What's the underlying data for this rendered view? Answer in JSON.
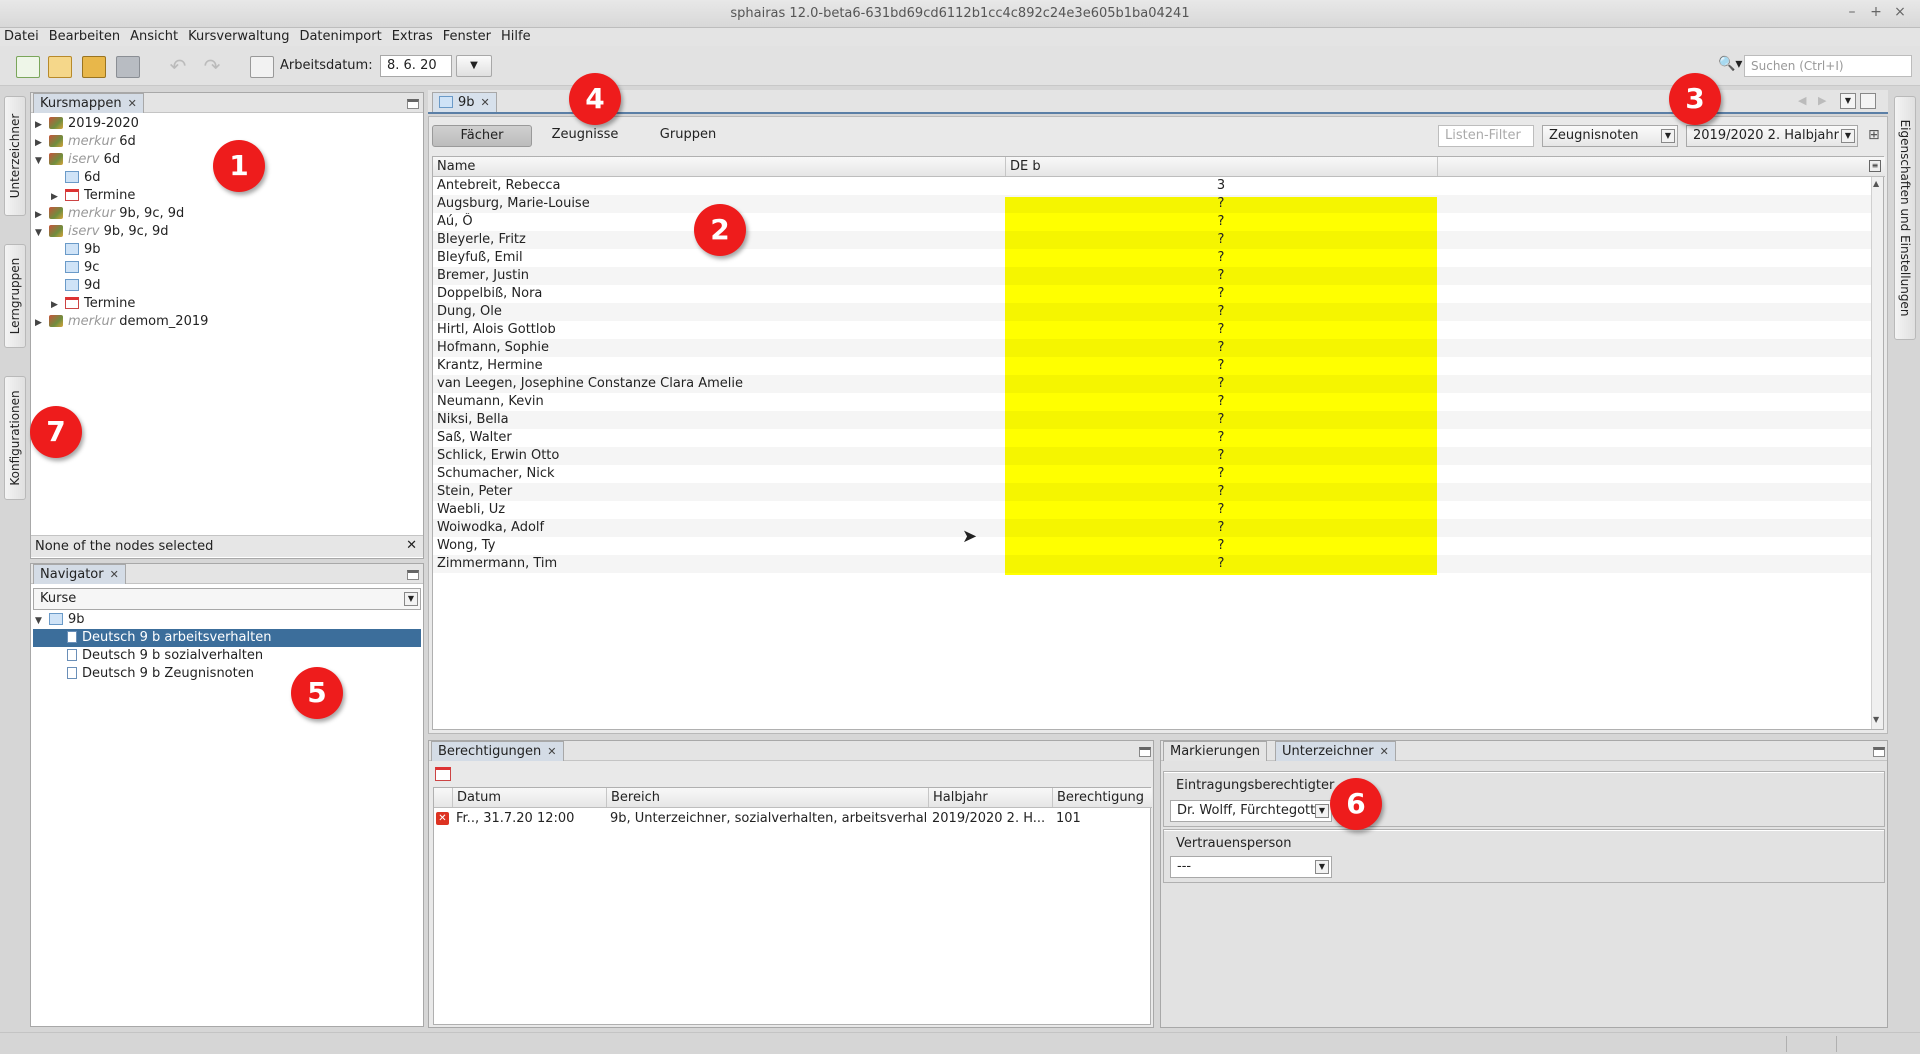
{
  "window": {
    "title": "sphairas 12.0-beta6-631bd69cd6112b1cc4c892c24e3e605b1ba04241"
  },
  "menu": [
    "Datei",
    "Bearbeiten",
    "Ansicht",
    "Kursverwaltung",
    "Datenimport",
    "Extras",
    "Fenster",
    "Hilfe"
  ],
  "toolbar": {
    "date_label": "Arbeitsdatum:",
    "date_value": "8. 6. 20",
    "search_placeholder": "Suchen (Ctrl+I)"
  },
  "left_vtabs": [
    "Unterzeichner",
    "Lerngruppen",
    "Konfigurationen"
  ],
  "right_vtab": "Eigenschaften und Einstellungen",
  "kursmappen": {
    "tab": "Kursmappen",
    "status": "None of the nodes selected",
    "tree": [
      {
        "label": "2019-2020",
        "prefix": ""
      },
      {
        "label": "6d",
        "prefix": "merkur"
      },
      {
        "label": "6d",
        "prefix": "iserv"
      },
      {
        "label": "6d",
        "prefix": ""
      },
      {
        "label": "Termine",
        "prefix": ""
      },
      {
        "label": "9b, 9c, 9d",
        "prefix": "merkur"
      },
      {
        "label": "9b, 9c, 9d",
        "prefix": "iserv"
      },
      {
        "label": "9b",
        "prefix": ""
      },
      {
        "label": "9c",
        "prefix": ""
      },
      {
        "label": "9d",
        "prefix": ""
      },
      {
        "label": "Termine",
        "prefix": ""
      },
      {
        "label": "demom_2019",
        "prefix": "merkur"
      }
    ]
  },
  "navigator": {
    "tab": "Navigator",
    "combo": "Kurse",
    "root": "9b",
    "items": [
      "Deutsch 9 b arbeitsverhalten",
      "Deutsch 9 b sozialverhalten",
      "Deutsch 9 b Zeugnisnoten"
    ]
  },
  "editor": {
    "tab": "9b",
    "segments": [
      "Fächer",
      "Zeugnisse",
      "Gruppen"
    ],
    "filter_placeholder": "Listen-Filter",
    "combo_type": "Zeugnisnoten",
    "combo_term": "2019/2020 2. Halbjahr",
    "columns": [
      "Name",
      "DE b"
    ],
    "rows": [
      {
        "name": "Antebreit, Rebecca",
        "grade": "3"
      },
      {
        "name": "Augsburg, Marie-Louise",
        "grade": "?"
      },
      {
        "name": "Aú, Ô",
        "grade": "?"
      },
      {
        "name": "Bleyerle, Fritz",
        "grade": "?"
      },
      {
        "name": "Bleyfuß, Emil",
        "grade": "?"
      },
      {
        "name": "Bremer, Justin",
        "grade": "?"
      },
      {
        "name": "Doppelbiß, Nora",
        "grade": "?"
      },
      {
        "name": "Dung, Ole",
        "grade": "?"
      },
      {
        "name": "Hirtl, Alois Gottlob",
        "grade": "?"
      },
      {
        "name": "Hofmann, Sophie",
        "grade": "?"
      },
      {
        "name": "Krantz, Hermine",
        "grade": "?"
      },
      {
        "name": "van Leegen, Josephine Constanze Clara Amelie",
        "grade": "?"
      },
      {
        "name": "Neumann, Kevin",
        "grade": "?"
      },
      {
        "name": "Niksi, Bella",
        "grade": "?"
      },
      {
        "name": "Saß, Walter",
        "grade": "?"
      },
      {
        "name": "Schlick, Erwin Otto",
        "grade": "?"
      },
      {
        "name": "Schumacher, Nick",
        "grade": "?"
      },
      {
        "name": "Stein, Peter",
        "grade": "?"
      },
      {
        "name": "Waebli, Uz",
        "grade": "?"
      },
      {
        "name": "Woiwodka, Adolf",
        "grade": "?"
      },
      {
        "name": "Wong, Ty",
        "grade": "?"
      },
      {
        "name": "Zimmermann, Tim",
        "grade": "?"
      }
    ]
  },
  "berechtigungen": {
    "tab": "Berechtigungen",
    "columns": [
      "Datum",
      "Bereich",
      "Halbjahr",
      "Berechtigung"
    ],
    "row": {
      "datum": "Fr.., 31.7.20 12:00",
      "bereich": "9b, Unterzeichner, sozialverhalten, arbeitsverhal...",
      "halbjahr": "2019/2020 2. H...",
      "berechtigung": "101"
    }
  },
  "unterzeichner": {
    "tabs": [
      "Markierungen",
      "Unterzeichner"
    ],
    "section1_label": "Eintragungsberechtigter",
    "section1_value": "Dr. Wolff, Fürchtegott",
    "section2_label": "Vertrauensperson",
    "section2_value": "---"
  },
  "callouts": [
    "1",
    "2",
    "3",
    "4",
    "5",
    "6",
    "7"
  ],
  "colors": {
    "highlight": "#ffff00",
    "selection": "#3c6e9b",
    "callout": "#ee1c1c"
  }
}
